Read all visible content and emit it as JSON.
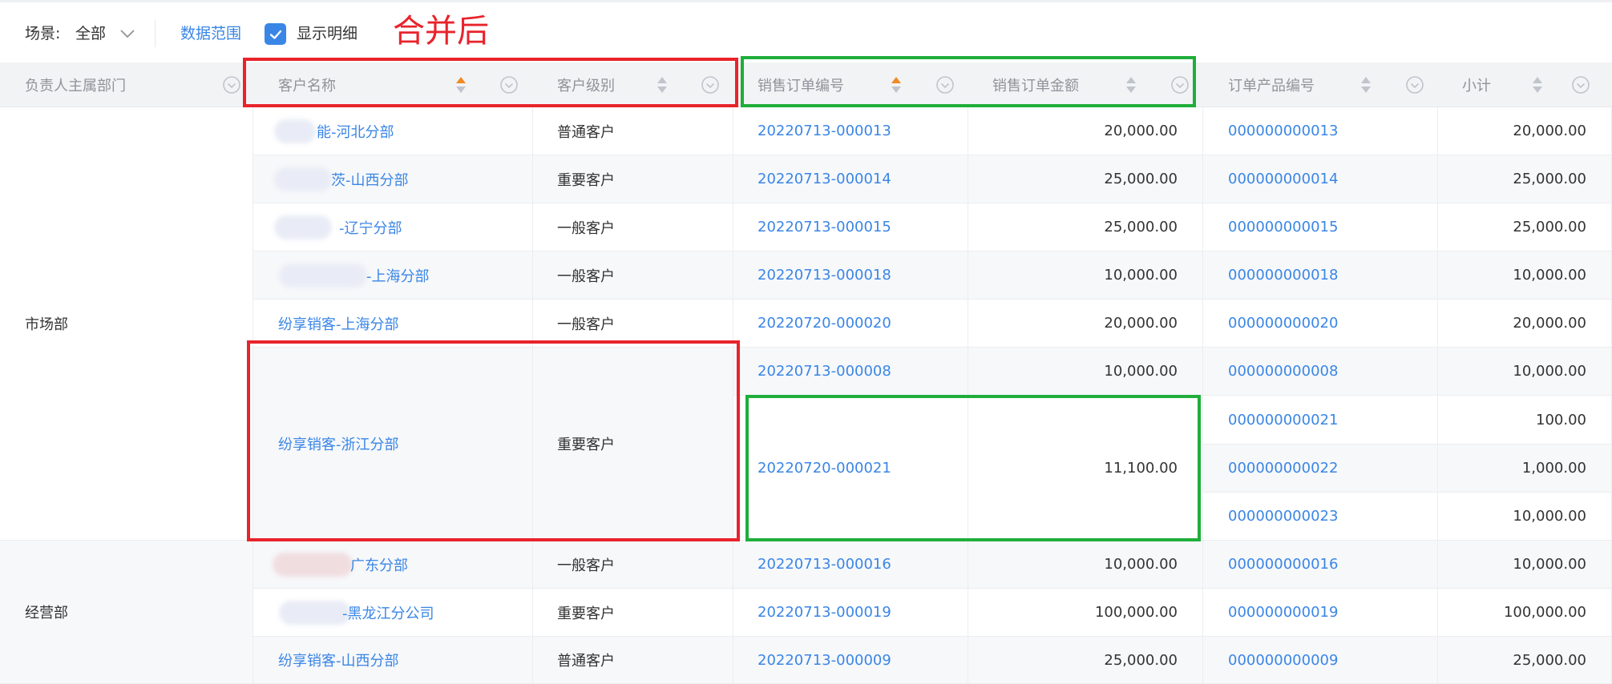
{
  "toolbar": {
    "scene_label": "场景:",
    "scene_value": "全部",
    "data_range": "数据范围",
    "show_detail": "显示明细",
    "show_detail_checked": true,
    "annotation": "合并后"
  },
  "colors": {
    "link": "#3a86e6",
    "sort_active": "#f08a24",
    "sort_inactive": "#c0c4cc",
    "annotation_red": "#e8232b",
    "annotation_green": "#1fae3a",
    "header_bg": "#f2f3f5"
  },
  "columns": [
    {
      "label": "负责人主属部门",
      "sort": "none"
    },
    {
      "label": "客户名称",
      "sort": "asc"
    },
    {
      "label": "客户级别",
      "sort": "inactive"
    },
    {
      "label": "销售订单编号",
      "sort": "asc"
    },
    {
      "label": "销售订单金额",
      "sort": "inactive"
    },
    {
      "label": "订单产品编号",
      "sort": "inactive"
    },
    {
      "label": "小计",
      "sort": "inactive"
    }
  ],
  "departments": [
    "市场部",
    "经营部"
  ],
  "customers": [
    "能-河北分部",
    "茨-山西分部",
    "-辽宁分部",
    "-上海分部",
    "纷享销客-上海分部",
    "纷享销客-浙江分部",
    "广东分部",
    "-黑龙江分公司",
    "纷享销客-山西分部"
  ],
  "levels": [
    "普通客户",
    "重要客户",
    "一般客户",
    "一般客户",
    "一般客户",
    "重要客户",
    "一般客户",
    "重要客户",
    "普通客户"
  ],
  "orders": [
    {
      "no": "20220713-000013",
      "amount": "20,000.00"
    },
    {
      "no": "20220713-000014",
      "amount": "25,000.00"
    },
    {
      "no": "20220713-000015",
      "amount": "25,000.00"
    },
    {
      "no": "20220713-000018",
      "amount": "10,000.00"
    },
    {
      "no": "20220720-000020",
      "amount": "20,000.00"
    },
    {
      "no": "20220713-000008",
      "amount": "10,000.00"
    },
    {
      "no": "20220720-000021",
      "amount": "11,100.00"
    },
    {
      "no": "20220713-000016",
      "amount": "10,000.00"
    },
    {
      "no": "20220713-000019",
      "amount": "100,000.00"
    },
    {
      "no": "20220713-000009",
      "amount": "25,000.00"
    }
  ],
  "products": [
    {
      "no": "000000000013",
      "subtotal": "20,000.00"
    },
    {
      "no": "000000000014",
      "subtotal": "25,000.00"
    },
    {
      "no": "000000000015",
      "subtotal": "25,000.00"
    },
    {
      "no": "000000000018",
      "subtotal": "10,000.00"
    },
    {
      "no": "000000000020",
      "subtotal": "20,000.00"
    },
    {
      "no": "000000000008",
      "subtotal": "10,000.00"
    },
    {
      "no": "000000000021",
      "subtotal": "100.00"
    },
    {
      "no": "000000000022",
      "subtotal": "1,000.00"
    },
    {
      "no": "000000000023",
      "subtotal": "10,000.00"
    },
    {
      "no": "000000000016",
      "subtotal": "10,000.00"
    },
    {
      "no": "000000000019",
      "subtotal": "100,000.00"
    },
    {
      "no": "000000000009",
      "subtotal": "25,000.00"
    }
  ]
}
